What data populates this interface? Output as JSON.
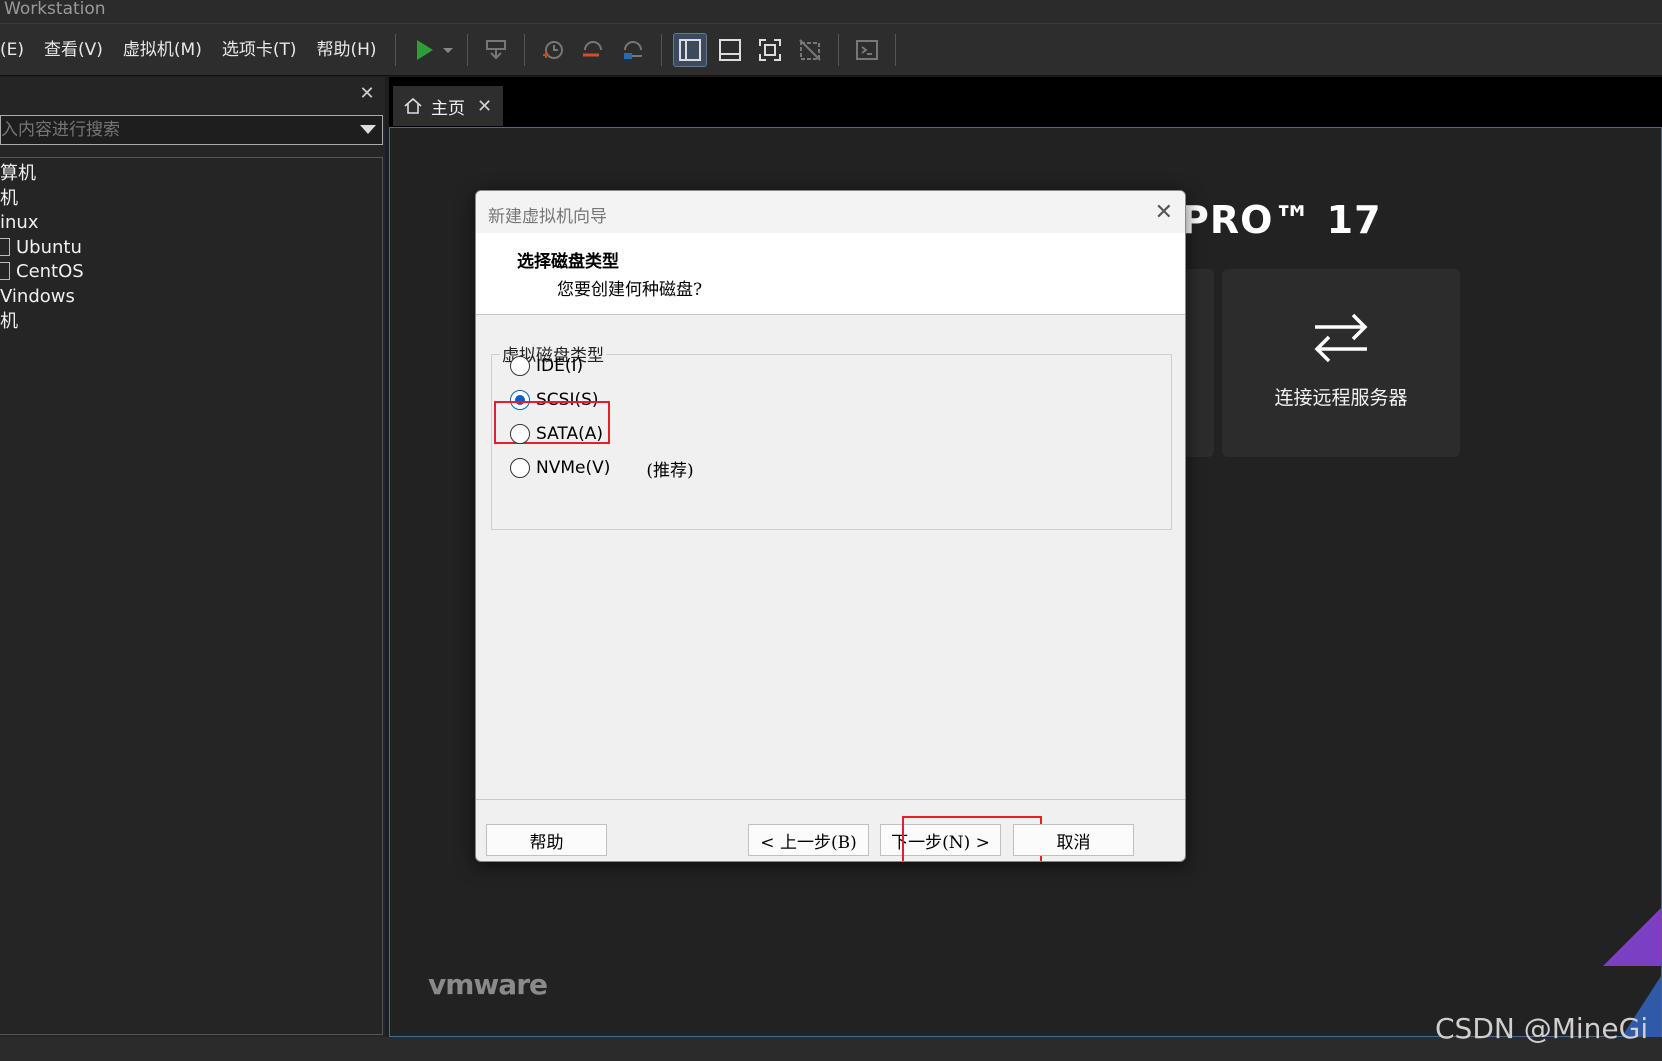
{
  "window": {
    "title": "Workstation"
  },
  "menu": [
    "(E)",
    "查看(V)",
    "虚拟机(M)",
    "选项卡(T)",
    "帮助(H)"
  ],
  "sidebar": {
    "close": "✕",
    "search_placeholder": "入内容进行搜索",
    "tree": [
      "算机",
      "机",
      "inux",
      "Ubuntu",
      "CentOS",
      "Vindows",
      "机"
    ]
  },
  "tab": {
    "label": "主页",
    "close": "✕"
  },
  "home": {
    "brand": "PRO™ 17",
    "card_label": "连接远程服务器",
    "vmware": "vmware"
  },
  "watermark": "CSDN @MineGi",
  "dialog": {
    "title": "新建虚拟机向导",
    "close": "✕",
    "heading": "选择磁盘类型",
    "subheading": "您要创建何种磁盘?",
    "group_label": "虚拟磁盘类型",
    "options": [
      {
        "label": "IDE(I)",
        "checked": false
      },
      {
        "label": "SCSI(S)",
        "checked": true
      },
      {
        "label": "SATA(A)",
        "checked": false
      },
      {
        "label": "NVMe(V)",
        "checked": false,
        "note": "(推荐)"
      }
    ],
    "buttons": {
      "help": "帮助",
      "back": "< 上一步(B)",
      "next": "下一步(N) >",
      "cancel": "取消"
    }
  },
  "colors": {
    "accent": "#0a5fc2",
    "highlight": "#e0202a",
    "purple": "#7b3fc4"
  }
}
